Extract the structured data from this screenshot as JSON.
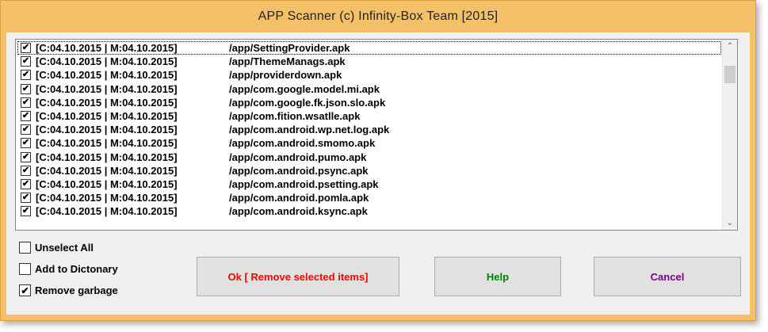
{
  "window": {
    "title": "APP Scanner (c) Infinity-Box Team [2015]"
  },
  "list": {
    "rows": [
      {
        "checked": true,
        "date": "[C:04.10.2015 | M:04.10.2015]",
        "path": "/app/SettingProvider.apk"
      },
      {
        "checked": true,
        "date": "[C:04.10.2015 | M:04.10.2015]",
        "path": "/app/ThemeManags.apk"
      },
      {
        "checked": true,
        "date": "[C:04.10.2015 | M:04.10.2015]",
        "path": "/app/providerdown.apk"
      },
      {
        "checked": true,
        "date": "[C:04.10.2015 | M:04.10.2015]",
        "path": "/app/com.google.model.mi.apk"
      },
      {
        "checked": true,
        "date": "[C:04.10.2015 | M:04.10.2015]",
        "path": "/app/com.google.fk.json.slo.apk"
      },
      {
        "checked": true,
        "date": "[C:04.10.2015 | M:04.10.2015]",
        "path": "/app/com.fition.wsatlle.apk"
      },
      {
        "checked": true,
        "date": "[C:04.10.2015 | M:04.10.2015]",
        "path": "/app/com.android.wp.net.log.apk"
      },
      {
        "checked": true,
        "date": "[C:04.10.2015 | M:04.10.2015]",
        "path": "/app/com.android.smomo.apk"
      },
      {
        "checked": true,
        "date": "[C:04.10.2015 | M:04.10.2015]",
        "path": "/app/com.android.pumo.apk"
      },
      {
        "checked": true,
        "date": "[C:04.10.2015 | M:04.10.2015]",
        "path": "/app/com.android.psync.apk"
      },
      {
        "checked": true,
        "date": "[C:04.10.2015 | M:04.10.2015]",
        "path": "/app/com.android.psetting.apk"
      },
      {
        "checked": true,
        "date": "[C:04.10.2015 | M:04.10.2015]",
        "path": "/app/com.android.pomla.apk"
      },
      {
        "checked": true,
        "date": "[C:04.10.2015 | M:04.10.2015]",
        "path": "/app/com.android.ksync.apk"
      }
    ],
    "scrollbar": {
      "up_icon": "chevron-up-icon",
      "down_icon": "chevron-down-icon"
    }
  },
  "options": {
    "unselect_all": {
      "label": "Unselect All",
      "checked": false
    },
    "add_to_dictionary": {
      "label": "Add to Dictonary",
      "checked": false
    },
    "remove_garbage": {
      "label": "Remove garbage",
      "checked": true
    }
  },
  "buttons": {
    "ok": {
      "label": "Ok [ Remove selected items]",
      "color": "#ff0000"
    },
    "help": {
      "label": "Help",
      "color": "#008000"
    },
    "cancel": {
      "label": "Cancel",
      "color": "#800080"
    }
  },
  "colors": {
    "frame": "#f4c168"
  }
}
